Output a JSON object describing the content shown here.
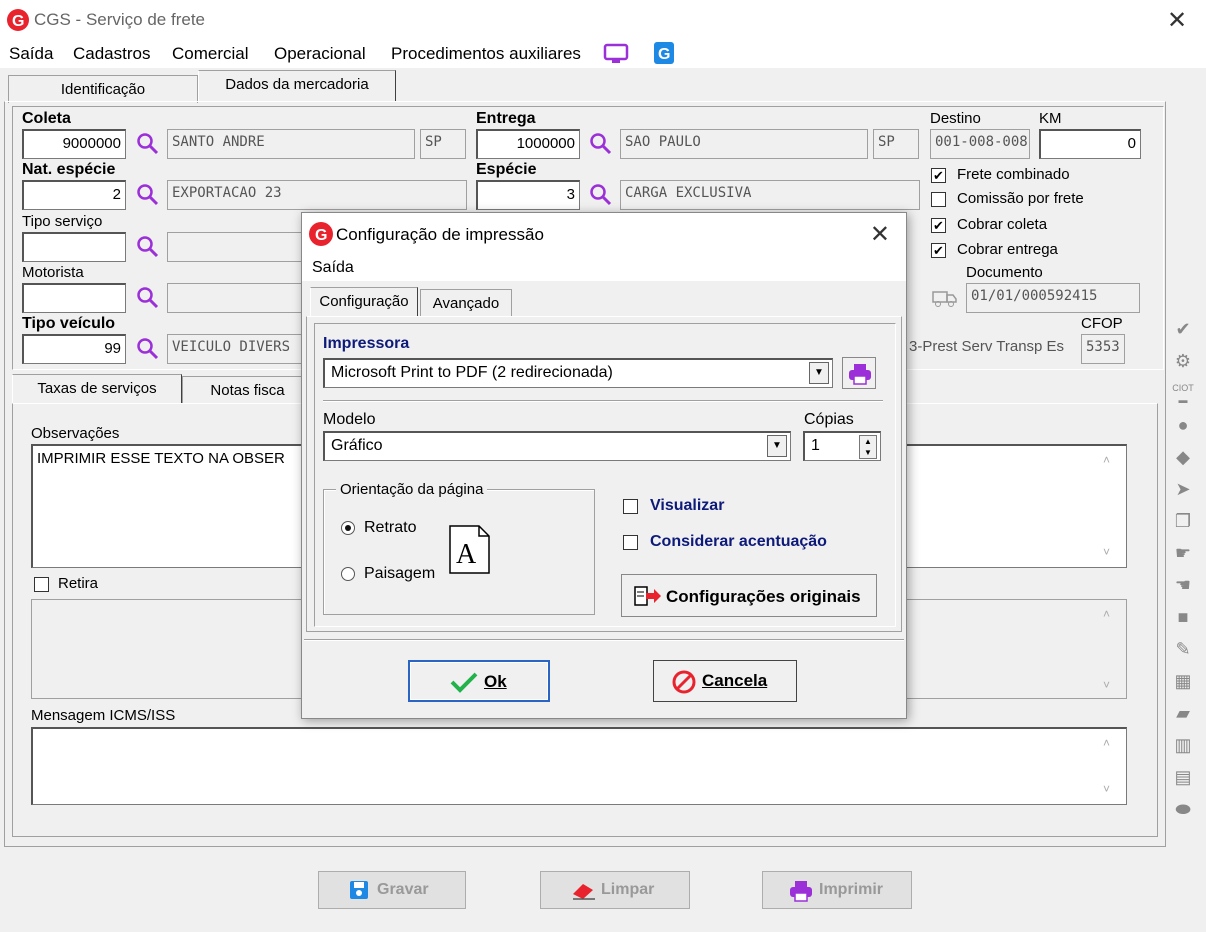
{
  "window": {
    "title": "CGS - Serviço de frete"
  },
  "menu": [
    "Saída",
    "Cadastros",
    "Comercial",
    "Operacional",
    "Procedimentos auxiliares"
  ],
  "tabs": [
    "Identificação",
    "Dados da mercadoria"
  ],
  "form": {
    "coleta_label": "Coleta",
    "coleta": "9000000",
    "coleta_cidade": "SANTO ANDRE",
    "coleta_uf": "SP",
    "entrega_label": "Entrega",
    "entrega": "1000000",
    "entrega_cidade": "SAO PAULO",
    "entrega_uf": "SP",
    "destino_label": "Destino",
    "destino": "001-008-008",
    "km_label": "KM",
    "km": "0",
    "nat_label": "Nat. espécie",
    "nat": "2",
    "nat_desc": "EXPORTACAO 23",
    "especie_label": "Espécie",
    "especie": "3",
    "especie_desc": "CARGA EXCLUSIVA",
    "tipo_servico_label": "Tipo serviço",
    "motorista_label": "Motorista",
    "tipo_veiculo_label": "Tipo veículo",
    "tipo_veiculo": "99",
    "tipo_veiculo_desc": "VEICULO DIVERS",
    "cfop_label": "CFOP",
    "cfop": "5353",
    "cfop_desc": "3-Prest Serv Transp Es",
    "documento_label": "Documento",
    "documento": "01/01/000592415",
    "checks": [
      {
        "label": "Frete combinado",
        "checked": true
      },
      {
        "label": "Comissão por frete",
        "checked": false
      },
      {
        "label": "Cobrar coleta",
        "checked": true
      },
      {
        "label": "Cobrar entrega",
        "checked": true
      }
    ]
  },
  "subtabs": [
    "Taxas de serviços",
    "Notas fisca"
  ],
  "obs": {
    "label": "Observações",
    "text": "IMPRIMIR ESSE TEXTO NA OBSER",
    "retira": "Retira",
    "icms_label": "Mensagem ICMS/ISS"
  },
  "footer": {
    "gravar": "Gravar",
    "limpar": "Limpar",
    "imprimir": "Imprimir"
  },
  "dialog": {
    "title": "Configuração de impressão",
    "menu": "Saída",
    "tabs": [
      "Configuração",
      "Avançado"
    ],
    "impressora_label": "Impressora",
    "impressora": "Microsoft Print to PDF (2 redirecionada)",
    "modelo_label": "Modelo",
    "modelo": "Gráfico",
    "copias_label": "Cópias",
    "copias": "1",
    "orientacao_label": "Orientação da página",
    "retrato": "Retrato",
    "paisagem": "Paisagem",
    "orientacao_selected": "Retrato",
    "page_glyph": "A",
    "visualizar": "Visualizar",
    "acentuacao": "Considerar acentuação",
    "config_originais": "Configurações originais",
    "ok": "Ok",
    "cancela": "Cancela"
  },
  "colors": {
    "accent": "#9b30d9",
    "brand": "#e8232d",
    "navy": "#0d1a7a",
    "ok_green": "#21b24a",
    "cancel_red": "#e8232d"
  }
}
